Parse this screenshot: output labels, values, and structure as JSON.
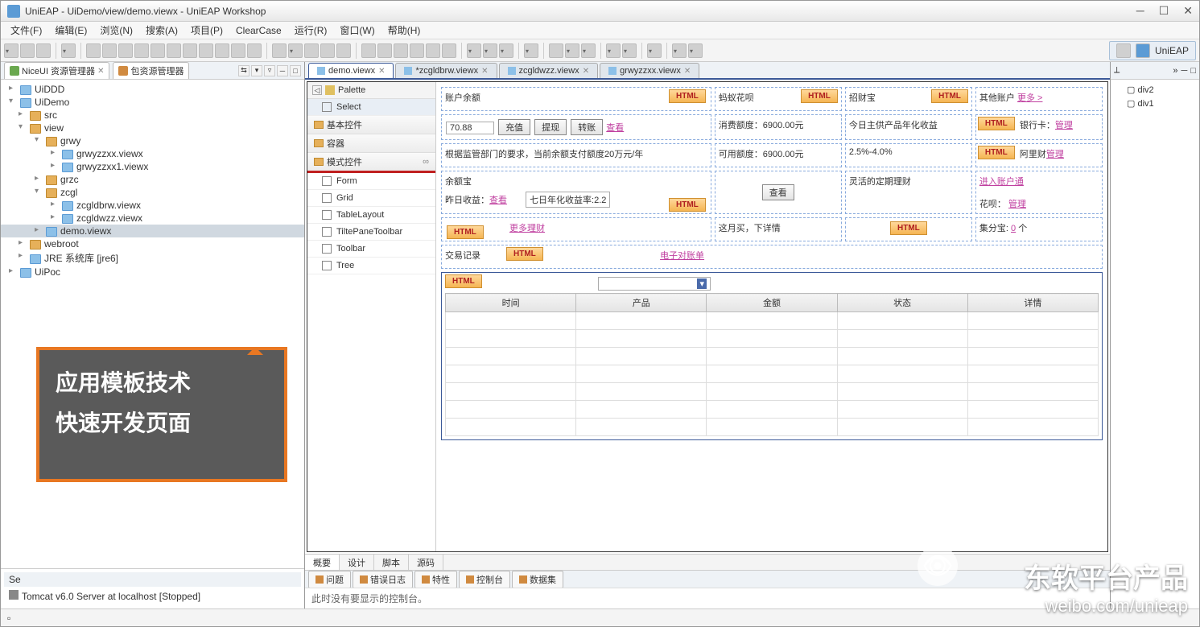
{
  "titlebar": {
    "title": "UniEAP  -  UiDemo/view/demo.viewx  -  UniEAP Workshop"
  },
  "menu": [
    "文件(F)",
    "编辑(E)",
    "浏览(N)",
    "搜索(A)",
    "项目(P)",
    "ClearCase",
    "运行(R)",
    "窗口(W)",
    "帮助(H)"
  ],
  "perspective": "UniEAP",
  "nav": {
    "views": [
      "NiceUI 资源管理器",
      "包资源管理器"
    ],
    "tree": [
      {
        "l": 0,
        "t": "UiDDD",
        "i": "x"
      },
      {
        "l": 0,
        "t": "UiDemo",
        "i": "x",
        "open": true
      },
      {
        "l": 1,
        "t": "src",
        "i": "f"
      },
      {
        "l": 1,
        "t": "view",
        "i": "f",
        "open": true
      },
      {
        "l": 2,
        "t": "grwy",
        "i": "f",
        "open": true
      },
      {
        "l": 3,
        "t": "grwyzzxx.viewx",
        "i": "x"
      },
      {
        "l": 3,
        "t": "grwyzzxx1.viewx",
        "i": "x"
      },
      {
        "l": 2,
        "t": "grzc",
        "i": "f"
      },
      {
        "l": 2,
        "t": "zcgl",
        "i": "f",
        "open": true
      },
      {
        "l": 3,
        "t": "zcgldbrw.viewx",
        "i": "x"
      },
      {
        "l": 3,
        "t": "zcgldwzz.viewx",
        "i": "x"
      },
      {
        "l": 2,
        "t": "demo.viewx",
        "i": "x",
        "sel": true
      },
      {
        "l": 1,
        "t": "webroot",
        "i": "f"
      },
      {
        "l": 1,
        "t": "JRE 系统库  [jre6]",
        "i": "x"
      },
      {
        "l": 0,
        "t": "UiPoc",
        "i": "x"
      }
    ],
    "servers_hd": "Se",
    "server": "Tomcat v6.0 Server at localhost  [Stopped]"
  },
  "callout": {
    "l1": "应用模板技术",
    "l2": "快速开发页面"
  },
  "editors": [
    {
      "t": "demo.viewx",
      "active": true,
      "dirty": false
    },
    {
      "t": "*zcgldbrw.viewx",
      "dirty": true
    },
    {
      "t": "zcgldwzz.viewx"
    },
    {
      "t": "grwyzzxx.viewx"
    }
  ],
  "palette": {
    "title": "Palette",
    "select": "Select",
    "cats": [
      "基本控件",
      "容器"
    ],
    "hlcat": "模式控件",
    "items": [
      "Form",
      "Grid",
      "TableLayout",
      "TiltePaneToolbar",
      "Toolbar",
      "Tree"
    ]
  },
  "canvas": {
    "balance_label": "账户余额",
    "balance_val": "70.88",
    "btn_recharge": "充值",
    "btn_withdraw": "提现",
    "btn_transfer": "转账",
    "lnk_view": "查看",
    "note": "根据监管部门的要求，当前余额支付额度20万元/年",
    "yeb": "余额宝",
    "yest": "昨日收益：",
    "lnk_view2": "查看",
    "seven": "七日年化收益率:2.2",
    "more_fin": "更多理财",
    "ant": "蚂蚁花呗",
    "zcb": "招财宝",
    "other": "其他账户",
    "more": "更多 >",
    "consume": "消费额度：",
    "consume_v": "6900.00元",
    "today": "今日主供产品年化收益",
    "bank": "银行卡：",
    "manage": "管理",
    "avail": "可用额度：",
    "avail_v": "6900.00元",
    "rate": "2.5%-4.0%",
    "ali": "阿里财",
    "enter": "进入账户通",
    "btn_view": "查看",
    "flex": "灵活的定期理财",
    "huabei": "花呗：",
    "month": "这月买，下详情",
    "jfb": "集分宝:",
    "jfb_v": "0",
    "ge": "个",
    "txn": "交易记录",
    "ebill": "电子对账单",
    "cols": [
      "时间",
      "产品",
      "金额",
      "状态",
      "详情"
    ],
    "html": "HTML"
  },
  "bottom_tabs": [
    "概要",
    "设计",
    "脚本",
    "源码"
  ],
  "outline": {
    "tabs": [
      "⟂",
      "»"
    ],
    "items": [
      "div2",
      "div1"
    ]
  },
  "views": [
    "问题",
    "错误日志",
    "特性",
    "控制台",
    "数据集"
  ],
  "console": "此时没有要显示的控制台。",
  "watermark": {
    "l1": "东软平台产品",
    "l2": "weibo.com/unieap"
  }
}
